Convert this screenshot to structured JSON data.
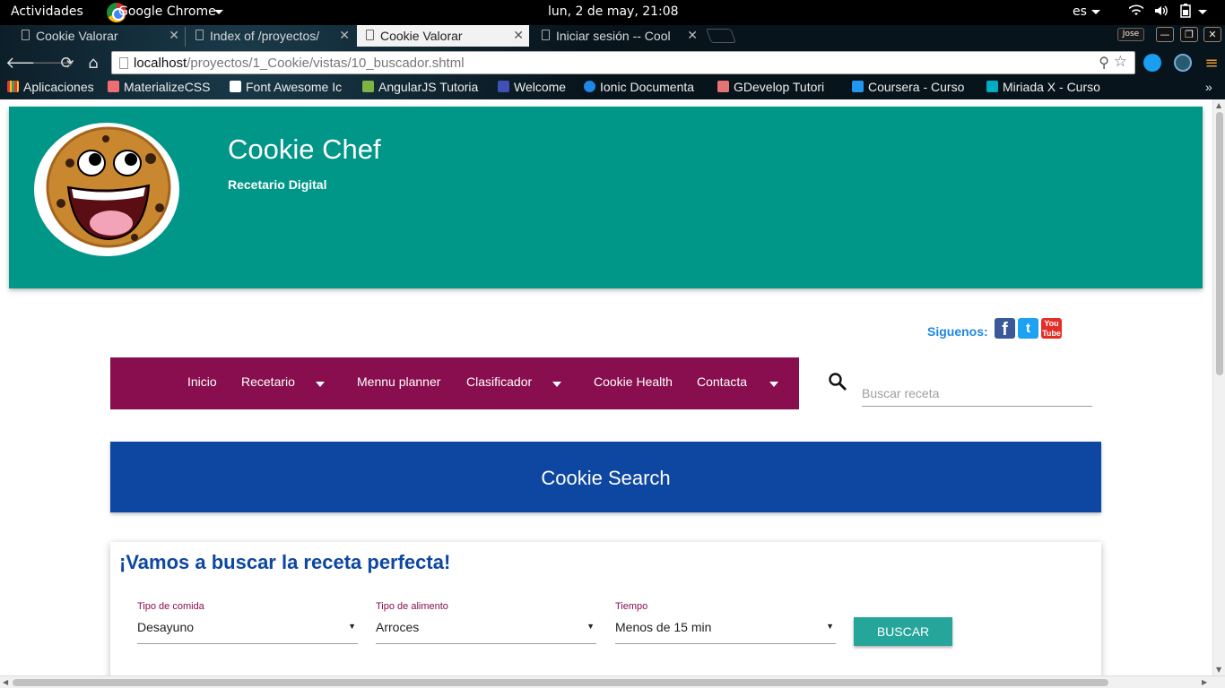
{
  "os": {
    "activities": "Actividades",
    "app_name": "Google Chrome",
    "clock": "lun,  2 de may, 21:08",
    "lang": "es",
    "icons": [
      "wifi-icon",
      "volume-icon",
      "battery-icon"
    ]
  },
  "browser": {
    "tabs": [
      {
        "label": "Cookie Valorar",
        "active": false
      },
      {
        "label": "Index of /proyectos/",
        "active": false
      },
      {
        "label": "Cookie Valorar",
        "active": true
      },
      {
        "label": "Iniciar sesión -- Cool",
        "active": false
      }
    ],
    "user": "Jose",
    "url_host": "localhost",
    "url_path": "/proyectos/1_Cookie/vistas/10_buscador.shtml",
    "bookmarks": [
      {
        "label": "Aplicaciones",
        "color": "#e53935"
      },
      {
        "label": "MaterializeCSS",
        "color": "#ee6e73"
      },
      {
        "label": "Font Awesome Ic",
        "color": "#ffffff"
      },
      {
        "label": "AngularJS Tutoria",
        "color": "#7cb342"
      },
      {
        "label": "Welcome",
        "color": "#3f51b5"
      },
      {
        "label": "Ionic Documenta",
        "color": "#1e88e5"
      },
      {
        "label": "GDevelop Tutori",
        "color": "#e57373"
      },
      {
        "label": "Coursera - Curso",
        "color": "#2196f3"
      },
      {
        "label": "Miriada X - Curso",
        "color": "#00acc1"
      }
    ]
  },
  "site": {
    "brand": "Cookie Chef",
    "tagline": "Recetario Digital",
    "follow_label": "Siguenos:",
    "social": [
      "facebook-icon",
      "twitter-icon",
      "youtube-icon"
    ],
    "menu": [
      {
        "label": "Inicio",
        "dropdown": false
      },
      {
        "label": "Recetario",
        "dropdown": true
      },
      {
        "label": "Mennu planner",
        "dropdown": false
      },
      {
        "label": "Clasificador",
        "dropdown": true
      },
      {
        "label": "Cookie Health",
        "dropdown": false
      },
      {
        "label": "Contacta",
        "dropdown": true
      }
    ],
    "search_placeholder": "Buscar receta",
    "banner": "Cookie Search",
    "card_title": "¡Vamos a buscar la receta perfecta!",
    "filters": [
      {
        "label": "Tipo de comida",
        "value": "Desayuno"
      },
      {
        "label": "Tipo de alimento",
        "value": "Arroces"
      },
      {
        "label": "Tiempo",
        "value": "Menos de 15 min"
      }
    ],
    "search_button": "BUSCAR",
    "colors": {
      "header": "#009688",
      "menu": "#880e4f",
      "banner": "#0d47a1",
      "button": "#26a69a"
    }
  }
}
